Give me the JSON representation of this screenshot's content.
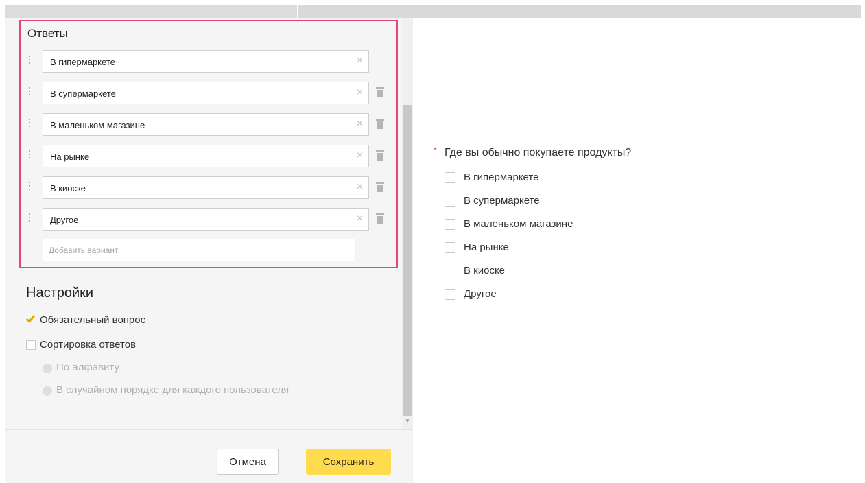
{
  "answers": {
    "title": "Ответы",
    "items": [
      {
        "label": "В гипермаркете"
      },
      {
        "label": "В супермаркете"
      },
      {
        "label": "В маленьком магазине"
      },
      {
        "label": "На рынке"
      },
      {
        "label": "В киоске"
      },
      {
        "label": "Другое"
      }
    ],
    "add_placeholder": "Добавить вариант",
    "clear_glyph": "×"
  },
  "settings": {
    "title": "Настройки",
    "required_label": "Обязательный вопрос",
    "required_checked": true,
    "sort_label": "Сортировка ответов",
    "sort_checked": false,
    "sort_options": [
      {
        "label": "По алфавиту"
      },
      {
        "label": "В случайном порядке для каждого пользователя"
      }
    ]
  },
  "footer": {
    "cancel_label": "Отмена",
    "save_label": "Сохранить"
  },
  "preview": {
    "required_mark": "*",
    "question": "Где вы обычно покупаете продукты?",
    "options": [
      {
        "label": "В гипермаркете"
      },
      {
        "label": "В супермаркете"
      },
      {
        "label": "В маленьком магазине"
      },
      {
        "label": "На рынке"
      },
      {
        "label": "В киоске"
      },
      {
        "label": "Другое"
      }
    ]
  },
  "colors": {
    "accent_border": "#e2487f",
    "save_button": "#ffdb4d",
    "checkmark": "#e5a400"
  }
}
